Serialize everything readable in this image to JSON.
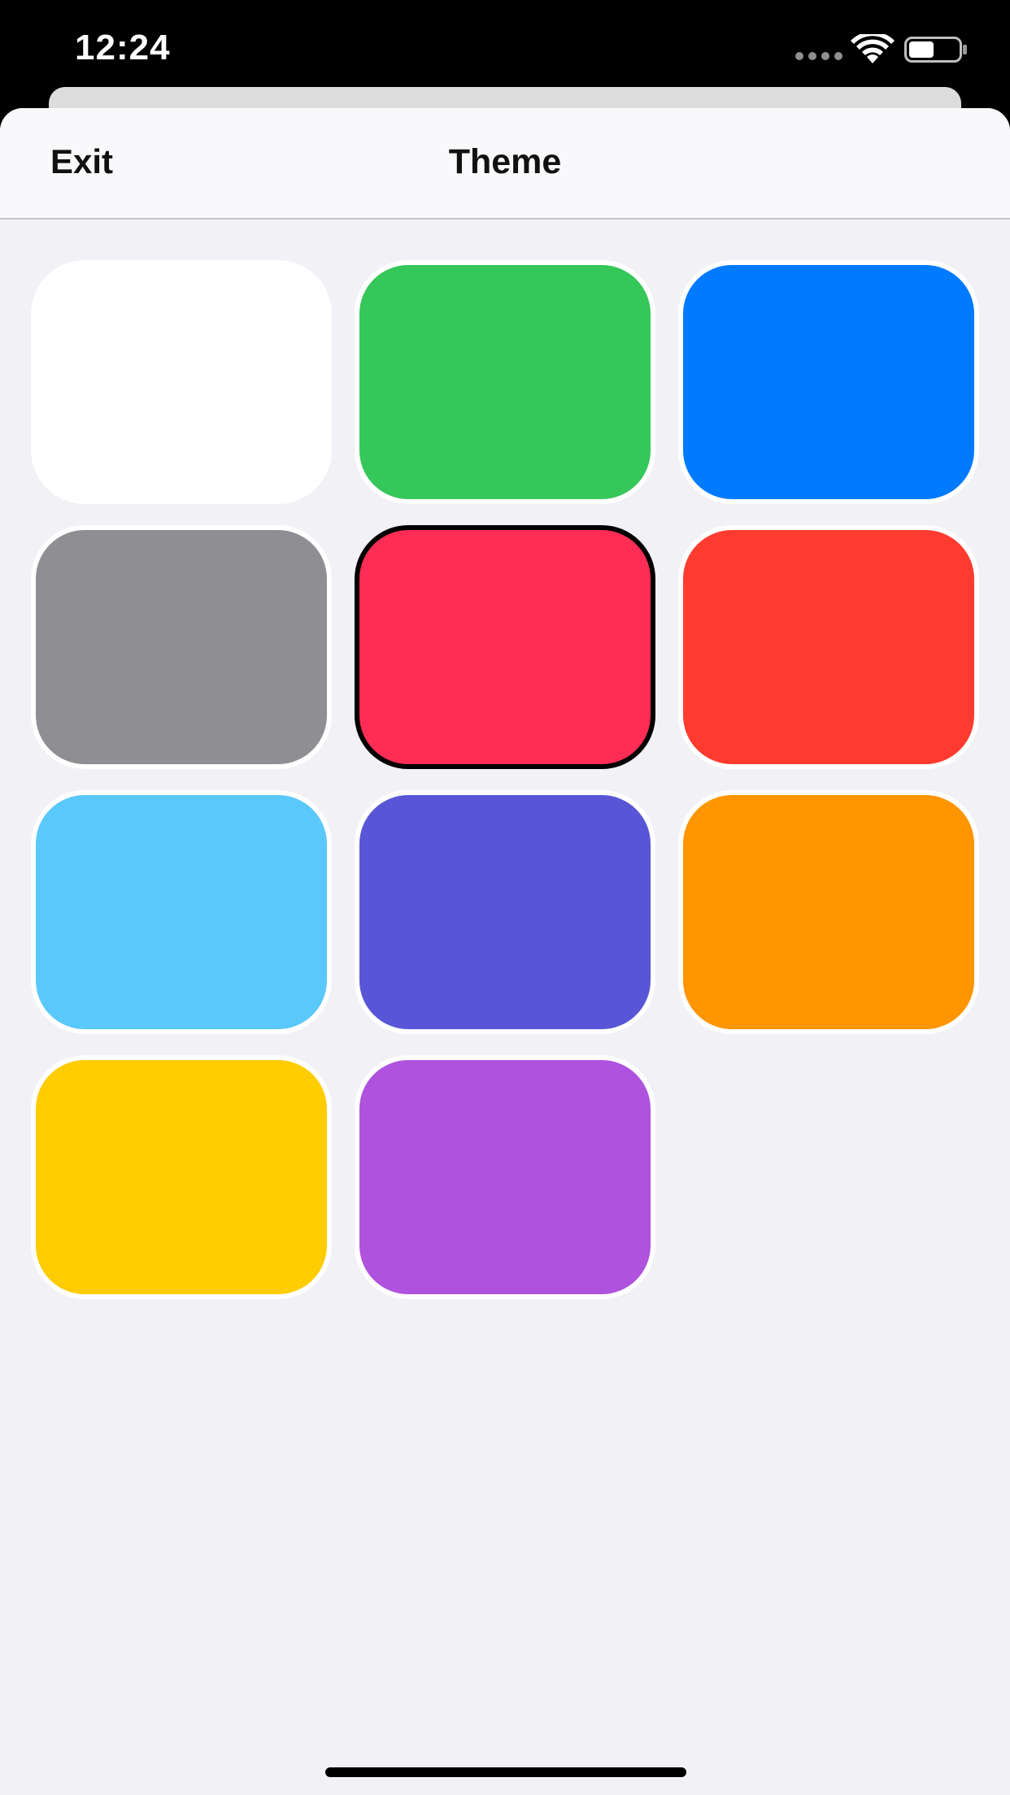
{
  "status_bar": {
    "time": "12:24",
    "icons": [
      "signal-icon",
      "wifi-icon",
      "battery-icon"
    ]
  },
  "nav": {
    "exit_label": "Exit",
    "title": "Theme"
  },
  "themes": {
    "selected": "pink",
    "swatches": [
      {
        "name": "white",
        "color": "#ffffff"
      },
      {
        "name": "green",
        "color": "#35c759"
      },
      {
        "name": "blue",
        "color": "#007aff"
      },
      {
        "name": "gray",
        "color": "#8e8e93"
      },
      {
        "name": "pink",
        "color": "#ff2d55"
      },
      {
        "name": "red",
        "color": "#ff3b30"
      },
      {
        "name": "teal",
        "color": "#5ac8fa"
      },
      {
        "name": "indigo",
        "color": "#5856d6"
      },
      {
        "name": "orange",
        "color": "#ff9500"
      },
      {
        "name": "yellow",
        "color": "#ffcc00"
      },
      {
        "name": "purple",
        "color": "#af52de"
      }
    ]
  }
}
